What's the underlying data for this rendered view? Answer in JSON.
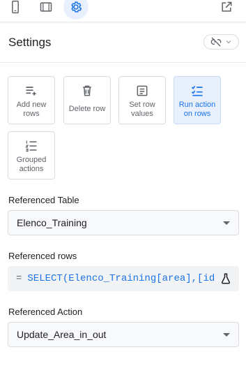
{
  "topbar": {
    "icons": [
      "phone-icon",
      "tablet-icon",
      "settings-gear-icon",
      "open-external-icon"
    ]
  },
  "header": {
    "title": "Settings",
    "toggle_icon": "link-off-icon"
  },
  "actions": [
    {
      "label": "Add new rows",
      "icon": "add-rows-icon",
      "selected": false
    },
    {
      "label": "Delete row",
      "icon": "trash-icon",
      "selected": false
    },
    {
      "label": "Set row values",
      "icon": "set-values-icon",
      "selected": false
    },
    {
      "label": "Run action on rows",
      "icon": "checklist-icon",
      "selected": true
    },
    {
      "label": "Grouped actions",
      "icon": "numbered-list-icon",
      "selected": false
    }
  ],
  "referenced_table": {
    "label": "Referenced Table",
    "value": "Elenco_Training"
  },
  "referenced_rows": {
    "label": "Referenced rows",
    "prefix": "=",
    "expression": "SELECT(Elenco_Training[area],[id"
  },
  "referenced_action": {
    "label": "Referenced Action",
    "value": "Update_Area_in_out"
  },
  "colors": {
    "accent": "#1a73e8",
    "selected_bg": "#e8f0fe",
    "border": "#dadce0"
  }
}
